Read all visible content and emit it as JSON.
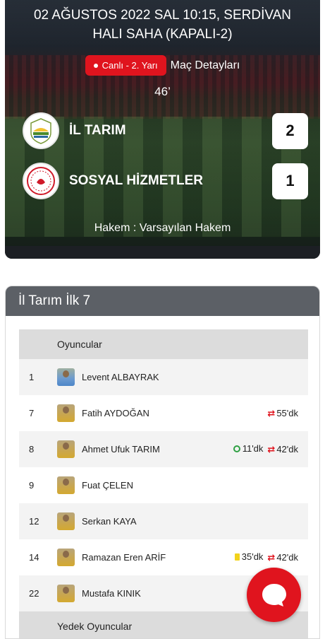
{
  "match": {
    "title": "02 AĞUSTOS 2022 SAL 10:15, SERDİVAN HALI SAHA (KAPALI-2)",
    "status_badge": "Canlı - 2. Yarı",
    "details_link": "Maç Detayları",
    "minute": "46’",
    "home": {
      "name": "İL TARIM",
      "score": "2"
    },
    "away": {
      "name": "SOSYAL HİZMETLER",
      "score": "1"
    },
    "referee": "Hakem : Varsayılan Hakem"
  },
  "lineup": {
    "title": "İl Tarım İlk 7",
    "players_header": "Oyuncular",
    "subs_header": "Yedek Oyuncular",
    "players": [
      {
        "number": "1",
        "name": "Levent ALBAYRAK",
        "events": []
      },
      {
        "number": "7",
        "name": "Fatih AYDOĞAN",
        "events": [
          {
            "type": "sub",
            "text": "55'dk"
          }
        ]
      },
      {
        "number": "8",
        "name": "Ahmet Ufuk TARIM",
        "events": [
          {
            "type": "goal",
            "text": "11'dk"
          },
          {
            "type": "sub",
            "text": "42'dk"
          }
        ]
      },
      {
        "number": "9",
        "name": "Fuat ÇELEN",
        "events": []
      },
      {
        "number": "12",
        "name": "Serkan KAYA",
        "events": []
      },
      {
        "number": "14",
        "name": "Ramazan Eren ARİF",
        "events": [
          {
            "type": "yellow-card",
            "text": "35'dk"
          },
          {
            "type": "sub",
            "text": "42'dk"
          }
        ]
      },
      {
        "number": "22",
        "name": "Mustafa KINIK",
        "events": []
      }
    ]
  },
  "colors": {
    "accent": "#e0141e",
    "header_gray": "#5c6066"
  }
}
